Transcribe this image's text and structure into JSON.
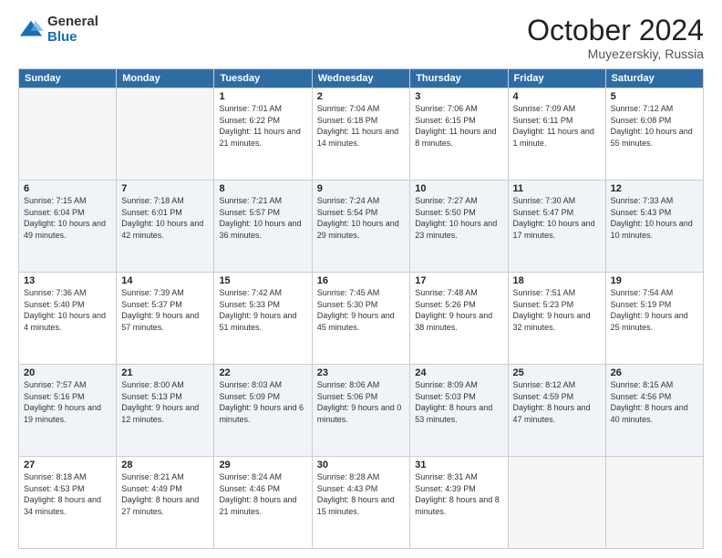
{
  "logo": {
    "general": "General",
    "blue": "Blue"
  },
  "header": {
    "month": "October 2024",
    "location": "Muyezerskiy, Russia"
  },
  "weekdays": [
    "Sunday",
    "Monday",
    "Tuesday",
    "Wednesday",
    "Thursday",
    "Friday",
    "Saturday"
  ],
  "weeks": [
    [
      null,
      null,
      {
        "day": 1,
        "sunrise": "7:01 AM",
        "sunset": "6:22 PM",
        "daylight": "11 hours and 21 minutes."
      },
      {
        "day": 2,
        "sunrise": "7:04 AM",
        "sunset": "6:18 PM",
        "daylight": "11 hours and 14 minutes."
      },
      {
        "day": 3,
        "sunrise": "7:06 AM",
        "sunset": "6:15 PM",
        "daylight": "11 hours and 8 minutes."
      },
      {
        "day": 4,
        "sunrise": "7:09 AM",
        "sunset": "6:11 PM",
        "daylight": "11 hours and 1 minute."
      },
      {
        "day": 5,
        "sunrise": "7:12 AM",
        "sunset": "6:08 PM",
        "daylight": "10 hours and 55 minutes."
      }
    ],
    [
      {
        "day": 6,
        "sunrise": "7:15 AM",
        "sunset": "6:04 PM",
        "daylight": "10 hours and 49 minutes."
      },
      {
        "day": 7,
        "sunrise": "7:18 AM",
        "sunset": "6:01 PM",
        "daylight": "10 hours and 42 minutes."
      },
      {
        "day": 8,
        "sunrise": "7:21 AM",
        "sunset": "5:57 PM",
        "daylight": "10 hours and 36 minutes."
      },
      {
        "day": 9,
        "sunrise": "7:24 AM",
        "sunset": "5:54 PM",
        "daylight": "10 hours and 29 minutes."
      },
      {
        "day": 10,
        "sunrise": "7:27 AM",
        "sunset": "5:50 PM",
        "daylight": "10 hours and 23 minutes."
      },
      {
        "day": 11,
        "sunrise": "7:30 AM",
        "sunset": "5:47 PM",
        "daylight": "10 hours and 17 minutes."
      },
      {
        "day": 12,
        "sunrise": "7:33 AM",
        "sunset": "5:43 PM",
        "daylight": "10 hours and 10 minutes."
      }
    ],
    [
      {
        "day": 13,
        "sunrise": "7:36 AM",
        "sunset": "5:40 PM",
        "daylight": "10 hours and 4 minutes."
      },
      {
        "day": 14,
        "sunrise": "7:39 AM",
        "sunset": "5:37 PM",
        "daylight": "9 hours and 57 minutes."
      },
      {
        "day": 15,
        "sunrise": "7:42 AM",
        "sunset": "5:33 PM",
        "daylight": "9 hours and 51 minutes."
      },
      {
        "day": 16,
        "sunrise": "7:45 AM",
        "sunset": "5:30 PM",
        "daylight": "9 hours and 45 minutes."
      },
      {
        "day": 17,
        "sunrise": "7:48 AM",
        "sunset": "5:26 PM",
        "daylight": "9 hours and 38 minutes."
      },
      {
        "day": 18,
        "sunrise": "7:51 AM",
        "sunset": "5:23 PM",
        "daylight": "9 hours and 32 minutes."
      },
      {
        "day": 19,
        "sunrise": "7:54 AM",
        "sunset": "5:19 PM",
        "daylight": "9 hours and 25 minutes."
      }
    ],
    [
      {
        "day": 20,
        "sunrise": "7:57 AM",
        "sunset": "5:16 PM",
        "daylight": "9 hours and 19 minutes."
      },
      {
        "day": 21,
        "sunrise": "8:00 AM",
        "sunset": "5:13 PM",
        "daylight": "9 hours and 12 minutes."
      },
      {
        "day": 22,
        "sunrise": "8:03 AM",
        "sunset": "5:09 PM",
        "daylight": "9 hours and 6 minutes."
      },
      {
        "day": 23,
        "sunrise": "8:06 AM",
        "sunset": "5:06 PM",
        "daylight": "9 hours and 0 minutes."
      },
      {
        "day": 24,
        "sunrise": "8:09 AM",
        "sunset": "5:03 PM",
        "daylight": "8 hours and 53 minutes."
      },
      {
        "day": 25,
        "sunrise": "8:12 AM",
        "sunset": "4:59 PM",
        "daylight": "8 hours and 47 minutes."
      },
      {
        "day": 26,
        "sunrise": "8:15 AM",
        "sunset": "4:56 PM",
        "daylight": "8 hours and 40 minutes."
      }
    ],
    [
      {
        "day": 27,
        "sunrise": "8:18 AM",
        "sunset": "4:53 PM",
        "daylight": "8 hours and 34 minutes."
      },
      {
        "day": 28,
        "sunrise": "8:21 AM",
        "sunset": "4:49 PM",
        "daylight": "8 hours and 27 minutes."
      },
      {
        "day": 29,
        "sunrise": "8:24 AM",
        "sunset": "4:46 PM",
        "daylight": "8 hours and 21 minutes."
      },
      {
        "day": 30,
        "sunrise": "8:28 AM",
        "sunset": "4:43 PM",
        "daylight": "8 hours and 15 minutes."
      },
      {
        "day": 31,
        "sunrise": "8:31 AM",
        "sunset": "4:39 PM",
        "daylight": "8 hours and 8 minutes."
      },
      null,
      null
    ]
  ]
}
